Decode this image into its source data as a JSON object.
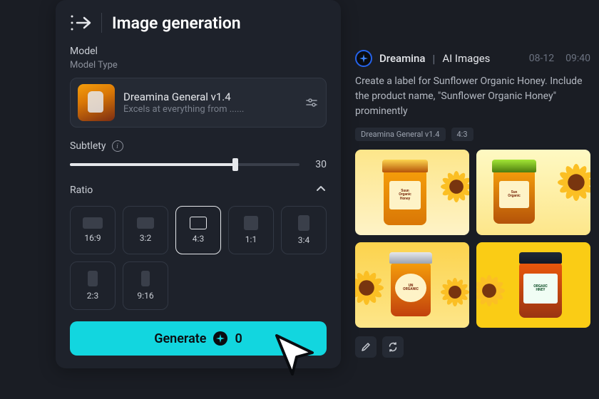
{
  "header": {
    "title": "Image generation"
  },
  "model": {
    "section_label": "Model",
    "type_label": "Model Type",
    "name": "Dreamina General v1.4",
    "description": "Excels at everything from ......"
  },
  "subtlety": {
    "label": "Subtlety",
    "value": "30"
  },
  "ratio": {
    "label": "Ratio",
    "selected": "4:3",
    "options": [
      "16:9",
      "3:2",
      "4:3",
      "1:1",
      "3:4",
      "2:3",
      "9:16"
    ]
  },
  "generate": {
    "label": "Generate",
    "credits": "0"
  },
  "result": {
    "app_name": "Dreamina",
    "subtype": "AI Images",
    "date": "08-12",
    "time": "09:40",
    "prompt": "Create a label for Sunflower Organic Honey. Include the product name, \"Sunflower Organic Honey\" prominently",
    "meta_model": "Dreamina General v1.4",
    "meta_ratio": "4:3",
    "img_labels": {
      "a": "Suun\nOrganic\nHoney",
      "b": "Sun\nOrganic",
      "c": "UN\nORGANIC",
      "d": "ORGAIIC\nHNEY"
    }
  }
}
